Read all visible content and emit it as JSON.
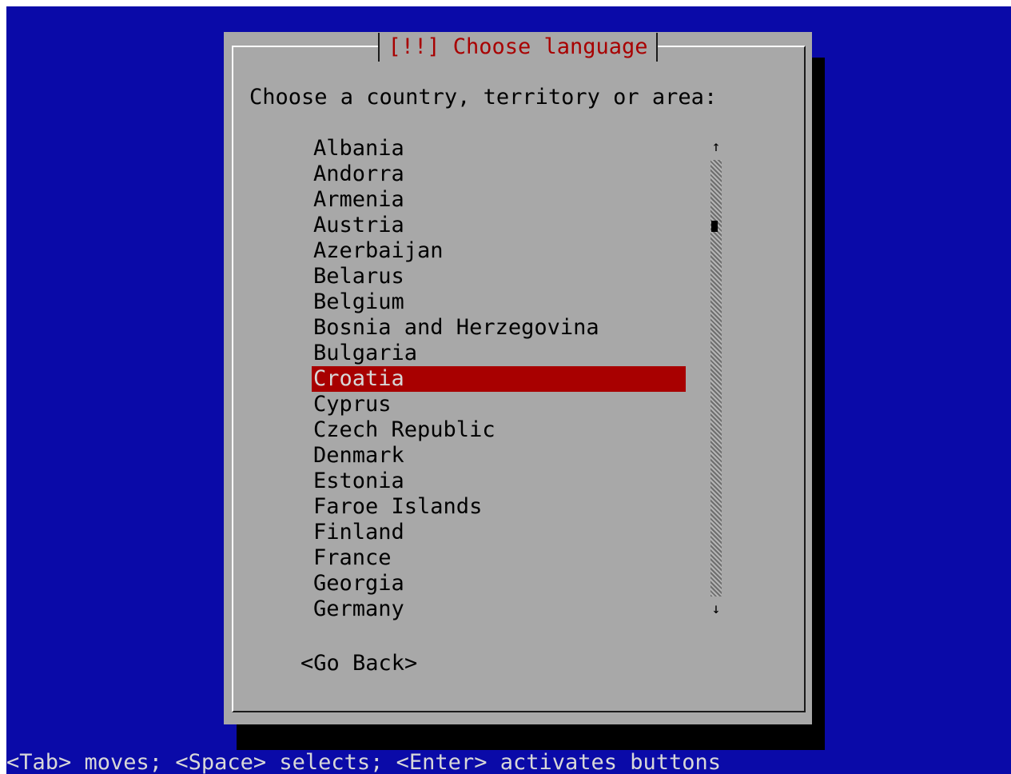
{
  "dialog": {
    "title": "[!!] Choose language",
    "prompt": "Choose a country, territory or area:",
    "countries": [
      "Albania",
      "Andorra",
      "Armenia",
      "Austria",
      "Azerbaijan",
      "Belarus",
      "Belgium",
      "Bosnia and Herzegovina",
      "Bulgaria",
      "Croatia",
      "Cyprus",
      "Czech Republic",
      "Denmark",
      "Estonia",
      "Faroe Islands",
      "Finland",
      "France",
      "Georgia",
      "Germany"
    ],
    "selected": "Croatia",
    "scroll_up_glyph": "↑",
    "scroll_down_glyph": "↓",
    "go_back": "<Go Back>"
  },
  "help_line": "<Tab> moves; <Space> selects; <Enter> activates buttons",
  "colors": {
    "background": "#0a0aa8",
    "dialog": "#a8a8a8",
    "title": "#a80000",
    "selection": "#a80000",
    "help_text": "#d8d8d8"
  }
}
